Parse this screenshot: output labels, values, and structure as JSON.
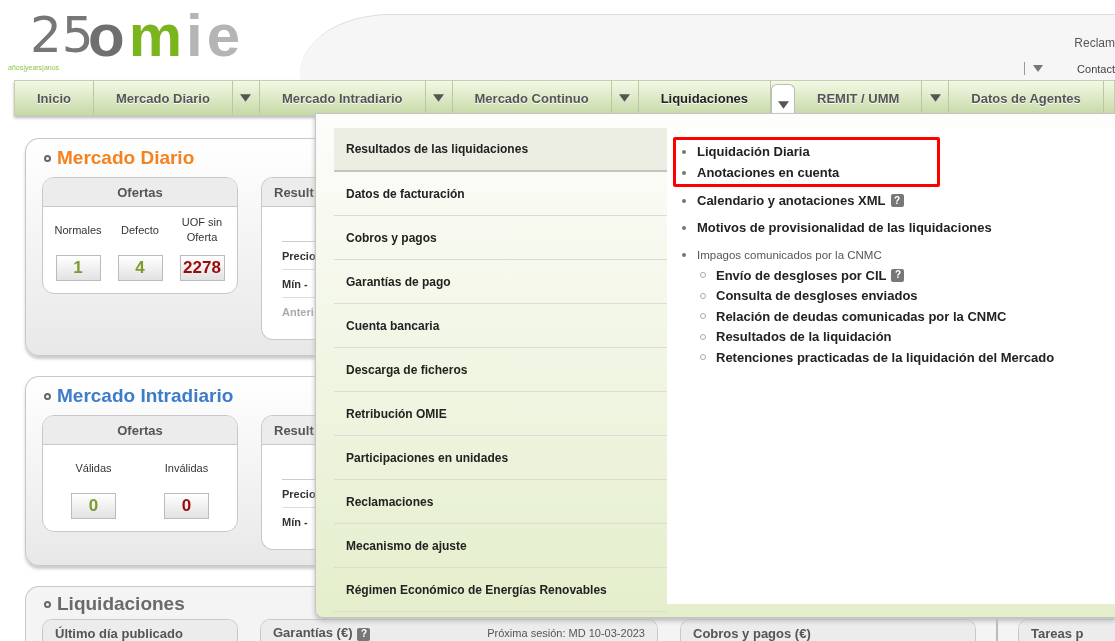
{
  "header": {
    "logo": {
      "year": "25",
      "tagline": "años|years|anos",
      "wordmark": [
        {
          "text": "o",
          "color": "#6f6f6f"
        },
        {
          "text": "m",
          "color": "#7ab51d"
        },
        {
          "text": "ie",
          "color": "#b5b5b5"
        }
      ]
    },
    "links": [
      "Reclam",
      "Contact"
    ]
  },
  "nav": [
    {
      "label": "Inicio",
      "dropdown": false,
      "selected": false
    },
    {
      "label": "Mercado Diario",
      "dropdown": true,
      "selected": false
    },
    {
      "label": "Mercado Intradiario",
      "dropdown": true,
      "selected": false
    },
    {
      "label": "Mercado Continuo",
      "dropdown": true,
      "selected": false
    },
    {
      "label": "Liquidaciones",
      "dropdown": true,
      "selected": true
    },
    {
      "label": "REMIT / UMM",
      "dropdown": true,
      "selected": false
    },
    {
      "label": "Datos de Agentes",
      "dropdown": false,
      "selected": false
    }
  ],
  "panels": [
    {
      "title": "Mercado Diario",
      "color": "#f5821f",
      "cards": [
        {
          "kind": "counters",
          "title": "Ofertas",
          "counters": [
            {
              "label": "Normales",
              "value": "1",
              "color": "#7f9a2e"
            },
            {
              "label": "Defecto",
              "value": "4",
              "color": "#7f9a2e"
            },
            {
              "label": "UOF sin Oferta",
              "value": "2278",
              "color": "#9c0a0a"
            }
          ]
        },
        {
          "kind": "results",
          "title": "Result",
          "rows": [
            {
              "label": "Precio",
              "muted": false
            },
            {
              "label": "Mín -",
              "muted": false
            },
            {
              "label": "Anteri",
              "muted": true
            }
          ]
        }
      ]
    },
    {
      "title": "Mercado Intradiario",
      "color": "#3d7cc9",
      "cards": [
        {
          "kind": "counters",
          "title": "Ofertas",
          "counters": [
            {
              "label": "Válidas",
              "value": "0",
              "color": "#7f9a2e"
            },
            {
              "label": "Inválidas",
              "value": "0",
              "color": "#9c0a0a"
            }
          ]
        },
        {
          "kind": "results",
          "title": "Result",
          "rows": [
            {
              "label": "Precio",
              "muted": false
            },
            {
              "label": "Mín -",
              "muted": false
            }
          ]
        }
      ]
    }
  ],
  "bottom_panel": {
    "title": "Liquidaciones",
    "color": "#6a6a6a",
    "cards": [
      {
        "title": "Último día publicado"
      },
      {
        "title": "Garantías (€)",
        "help": "?",
        "note": "Próxima sesión: MD 10-03-2023"
      },
      {
        "title": "Cobros y pagos (€)"
      },
      {
        "title": "Tareas p"
      }
    ]
  },
  "dropdown": {
    "categories": [
      {
        "label": "Resultados de las liquidaciones",
        "selected": true
      },
      {
        "label": "Datos de facturación",
        "selected": false
      },
      {
        "label": "Cobros y pagos",
        "selected": false
      },
      {
        "label": "Garantías de pago",
        "selected": false
      },
      {
        "label": "Cuenta bancaria",
        "selected": false
      },
      {
        "label": "Descarga de ficheros",
        "selected": false
      },
      {
        "label": "Retribución OMIE",
        "selected": false
      },
      {
        "label": "Participaciones en unidades",
        "selected": false
      },
      {
        "label": "Reclamaciones",
        "selected": false
      },
      {
        "label": "Mecanismo de ajuste",
        "selected": false
      },
      {
        "label": "Régimen Económico de Energías Renovables",
        "selected": false
      }
    ],
    "links": [
      {
        "kind": "link",
        "label": "Liquidación Diaria",
        "highlighted": true
      },
      {
        "kind": "link",
        "label": "Anotaciones en cuenta",
        "highlighted": true
      },
      {
        "kind": "link",
        "label": "Calendario y anotaciones XML",
        "help": "?",
        "highlighted": false
      },
      {
        "kind": "link",
        "label": "Motivos de provisionalidad de las liquidaciones",
        "highlighted": false
      },
      {
        "kind": "group",
        "label": "Impagos comunicados por la CNMC",
        "highlighted": false,
        "children": [
          {
            "label": "Envío de desgloses por CIL",
            "help": "?"
          },
          {
            "label": "Consulta de desgloses enviados"
          },
          {
            "label": "Relación de deudas comunicadas por la CNMC"
          },
          {
            "label": "Resultados de la liquidación"
          },
          {
            "label": "Retenciones practicadas de la liquidación del Mercado"
          }
        ]
      }
    ]
  }
}
